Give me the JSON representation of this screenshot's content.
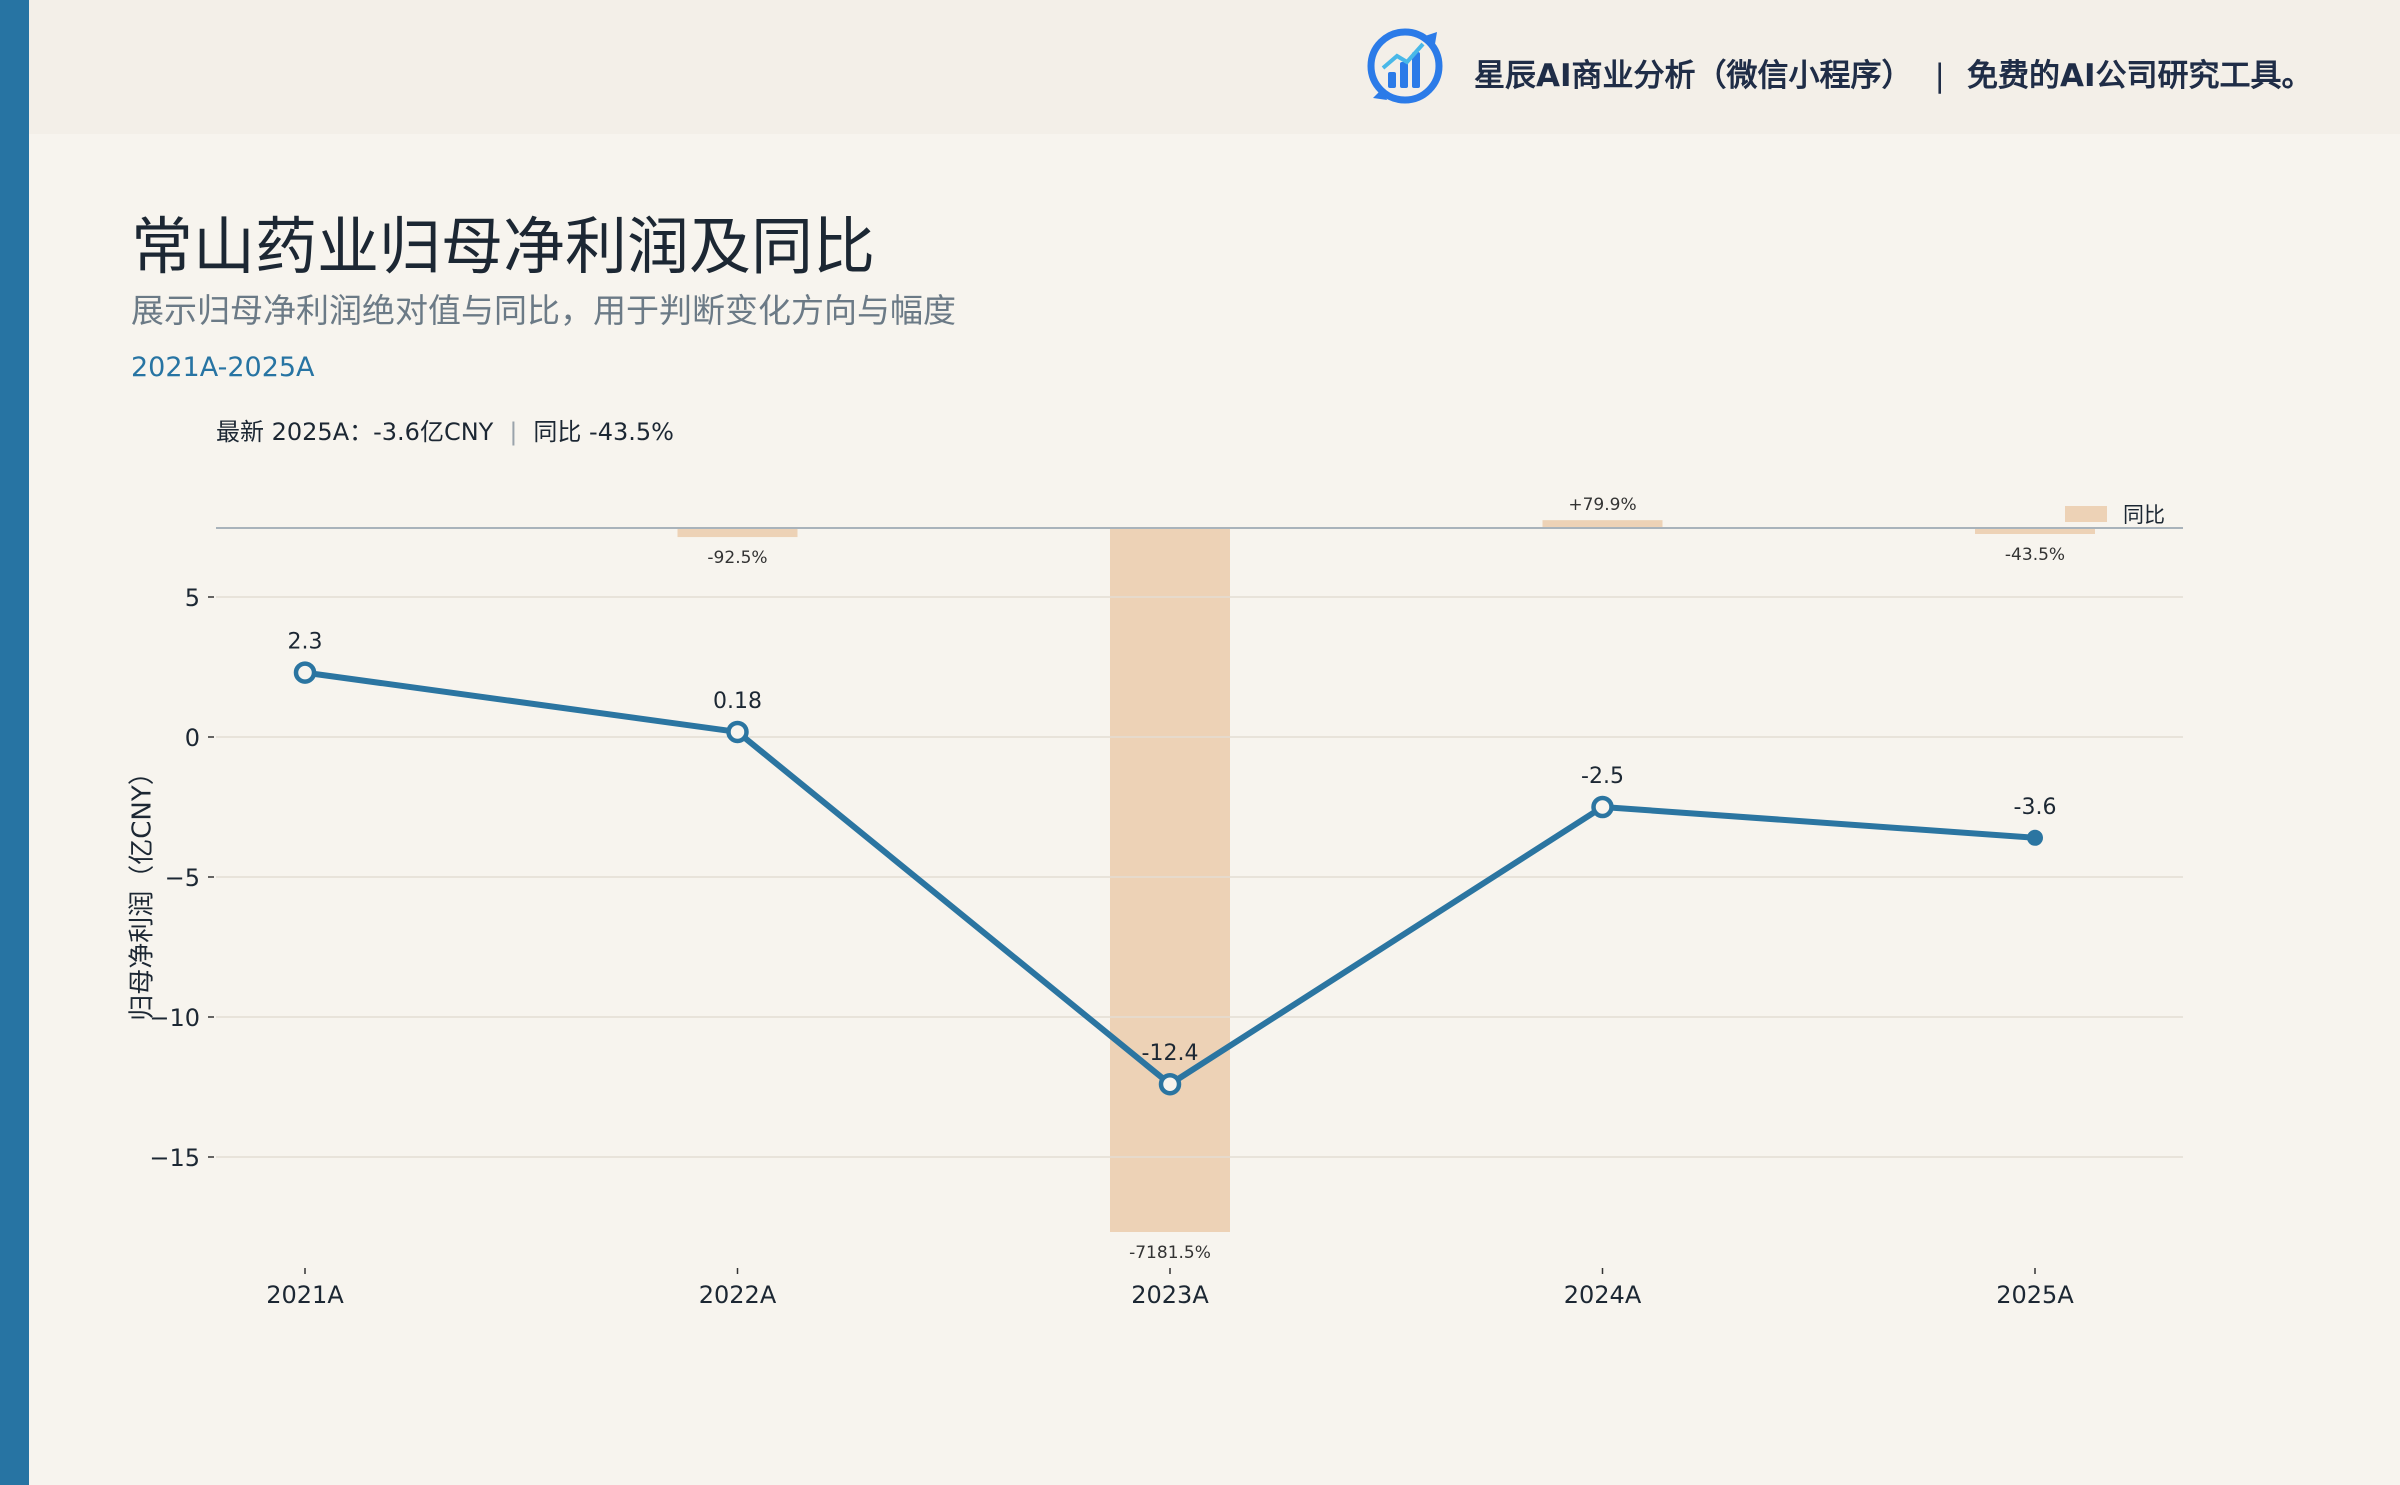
{
  "brand": {
    "name": "星辰AI商业分析（微信小程序）",
    "separator": "|",
    "slogan": "免费的AI公司研究工具。",
    "logo_icon": "bar-chart-logo-icon"
  },
  "header": {
    "title": "常山药业归母净利润及同比",
    "subtitle": "展示归母净利润绝对值与同比，用于判断变化方向与幅度",
    "period": "2021A-2025A",
    "latest_label": "最新 2025A：-3.6亿CNY",
    "latest_sep": "|",
    "latest_yoy": "同比 -43.5%"
  },
  "colors": {
    "line": "#2b75a1",
    "bar": "#edd2b6",
    "accent": "#2774a3",
    "background": "#f7f4ee"
  },
  "chart_data": {
    "type": "line",
    "categories": [
      "2021A",
      "2022A",
      "2023A",
      "2024A",
      "2025A"
    ],
    "ylabel": "归母净利润（亿CNY）",
    "ylim": [
      -18.5,
      7.5
    ],
    "yticks": [
      5,
      0,
      -5,
      -10,
      -15
    ],
    "ytick_labels": [
      "5",
      "0",
      "−5",
      "−10",
      "−15"
    ],
    "grid": true,
    "series": [
      {
        "values": [
          2.3,
          0.18,
          -12.4,
          -2.5,
          -3.6
        ],
        "data_labels": [
          "2.3",
          "0.18",
          "-12.4",
          "-2.5",
          "-3.6"
        ]
      }
    ],
    "yoy": {
      "name": "同比",
      "values": [
        -92.5,
        -7181.5,
        79.9,
        -43.5
      ],
      "categories": [
        "2022A",
        "2023A",
        "2024A",
        "2025A"
      ],
      "data_labels": [
        "-92.5%",
        "-7181.5%",
        "+79.9%",
        "-43.5%"
      ]
    },
    "legend": {
      "position": "top-right",
      "entries": [
        "同比"
      ]
    }
  }
}
